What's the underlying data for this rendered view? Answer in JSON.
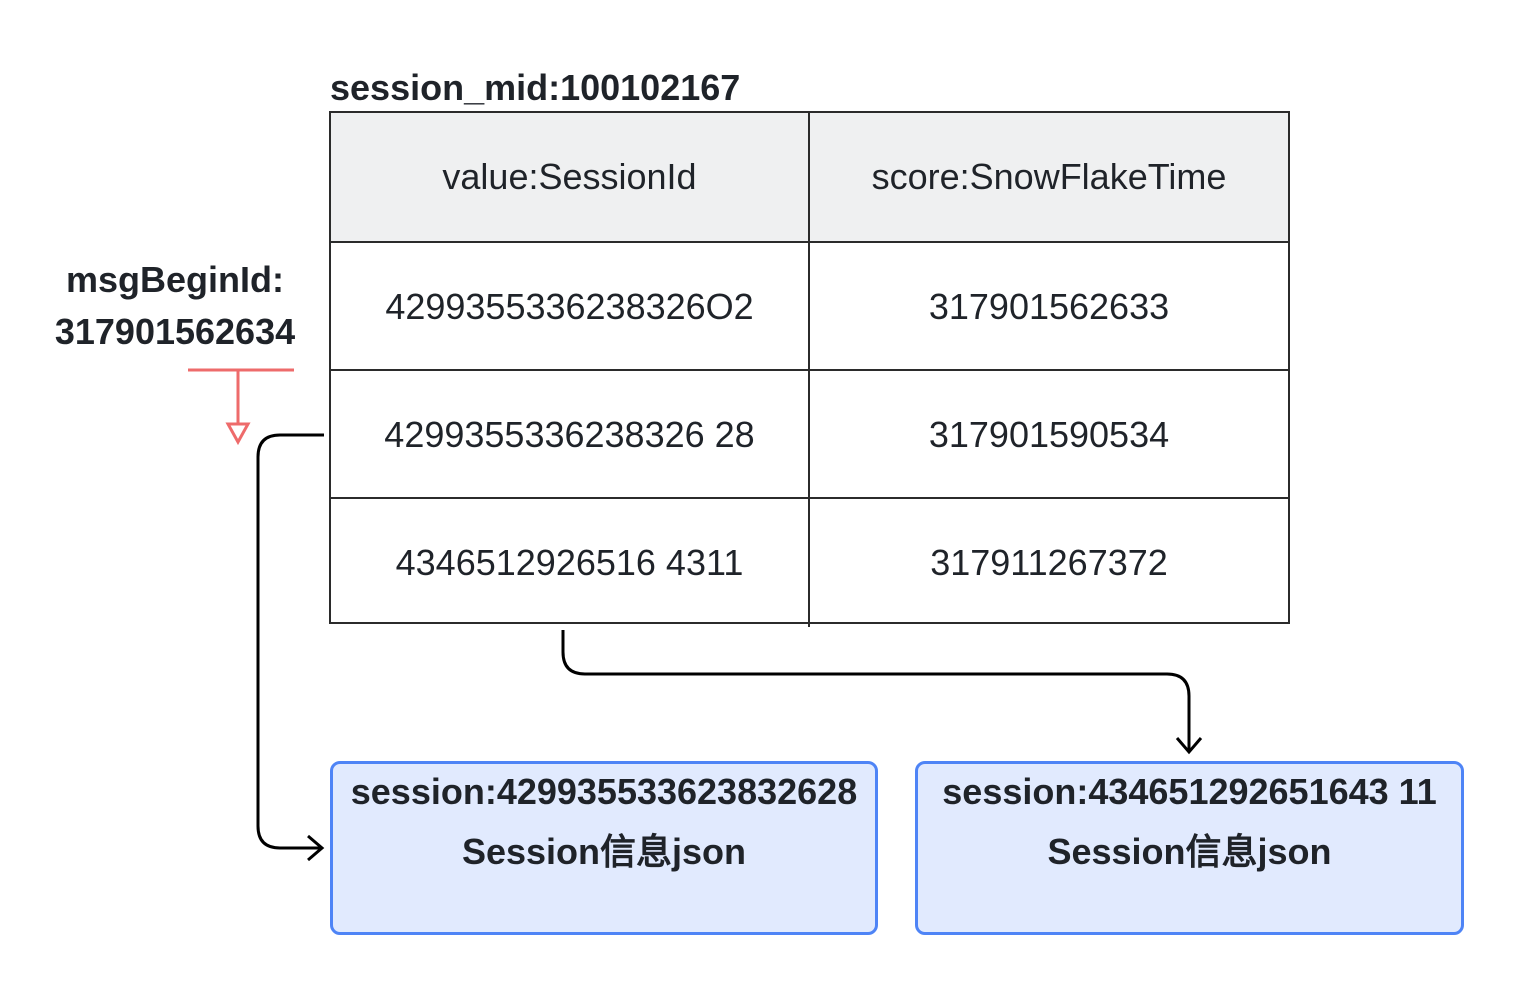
{
  "diagram": {
    "title": "session_mid:100102167",
    "table": {
      "headers": [
        "value:SessionId",
        "score:SnowFlakeTime"
      ],
      "rows": [
        [
          "4299355336238326O2",
          "317901562633"
        ],
        [
          "4299355336238326 28",
          "317901590534"
        ],
        [
          "4346512926516 4311",
          "317911267372"
        ]
      ]
    },
    "side_label": {
      "line1": "msgBeginId:",
      "line2": "317901562634"
    },
    "boxes": [
      {
        "line1": "session:429935533623832628",
        "line2": "Session信息json"
      },
      {
        "line1": "session:434651292651643 11",
        "line2": "Session信息json"
      }
    ],
    "colors": {
      "header_bg": "#eff0f1",
      "box_bg": "#e1eafe",
      "box_border": "#4e84f6",
      "marker_red": "#ee6b6b",
      "connector": "#000000"
    }
  }
}
